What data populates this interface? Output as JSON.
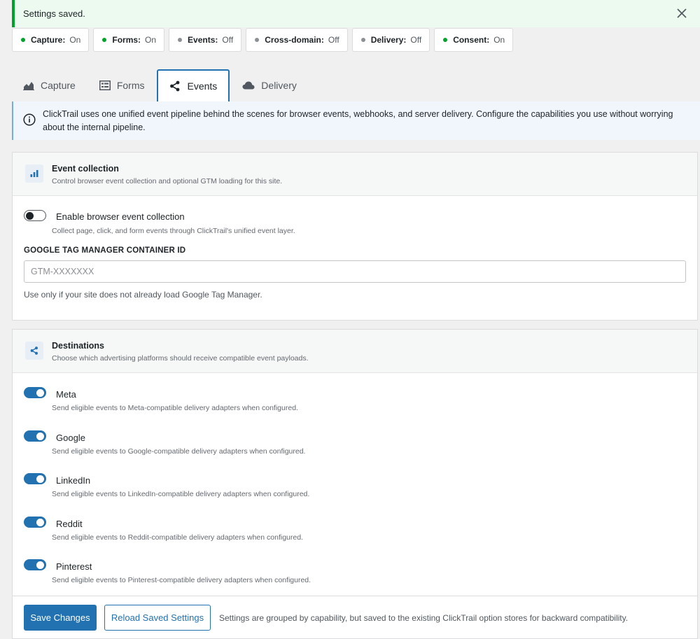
{
  "notice": {
    "text": "Settings saved.",
    "dismiss_icon": "close-icon"
  },
  "status_pills": [
    {
      "name": "Capture:",
      "state": "On",
      "color": "#00a32a"
    },
    {
      "name": "Forms:",
      "state": "On",
      "color": "#00a32a"
    },
    {
      "name": "Events:",
      "state": "Off",
      "color": "#8c8f94"
    },
    {
      "name": "Cross-domain:",
      "state": "Off",
      "color": "#8c8f94"
    },
    {
      "name": "Delivery:",
      "state": "Off",
      "color": "#8c8f94"
    },
    {
      "name": "Consent:",
      "state": "On",
      "color": "#00a32a"
    }
  ],
  "tabs": [
    {
      "label": "Capture",
      "icon": "chart-area-icon"
    },
    {
      "label": "Forms",
      "icon": "form-icon"
    },
    {
      "label": "Events",
      "icon": "share-icon",
      "active": true
    },
    {
      "label": "Delivery",
      "icon": "cloud-icon"
    }
  ],
  "info": {
    "text": "ClickTrail uses one unified event pipeline behind the scenes for browser events, webhooks, and server delivery. Configure the capabilities you use without worrying about the internal pipeline."
  },
  "event_collection": {
    "title": "Event collection",
    "subtitle": "Control browser event collection and optional GTM loading for this site.",
    "toggle_label": "Enable browser event collection",
    "toggle_desc": "Collect page, click, and form events through ClickTrail's unified event layer.",
    "toggle_on": false,
    "gtm_label": "GOOGLE TAG MANAGER CONTAINER ID",
    "gtm_value": "",
    "gtm_placeholder": "GTM-XXXXXXX",
    "gtm_help": "Use only if your site does not already load Google Tag Manager."
  },
  "destinations": {
    "title": "Destinations",
    "subtitle": "Choose which advertising platforms should receive compatible event payloads.",
    "items": [
      {
        "label": "Meta",
        "desc": "Send eligible events to Meta-compatible delivery adapters when configured.",
        "on": true
      },
      {
        "label": "Google",
        "desc": "Send eligible events to Google-compatible delivery adapters when configured.",
        "on": true
      },
      {
        "label": "LinkedIn",
        "desc": "Send eligible events to LinkedIn-compatible delivery adapters when configured.",
        "on": true
      },
      {
        "label": "Reddit",
        "desc": "Send eligible events to Reddit-compatible delivery adapters when configured.",
        "on": true
      },
      {
        "label": "Pinterest",
        "desc": "Send eligible events to Pinterest-compatible delivery adapters when configured.",
        "on": true
      }
    ]
  },
  "footer": {
    "save_label": "Save Changes",
    "reload_label": "Reload Saved Settings",
    "note": "Settings are grouped by capability, but saved to the existing ClickTrail option stores for backward compatibility."
  },
  "colors": {
    "accent": "#2271b1",
    "success": "#00a32a",
    "muted": "#8c8f94"
  }
}
